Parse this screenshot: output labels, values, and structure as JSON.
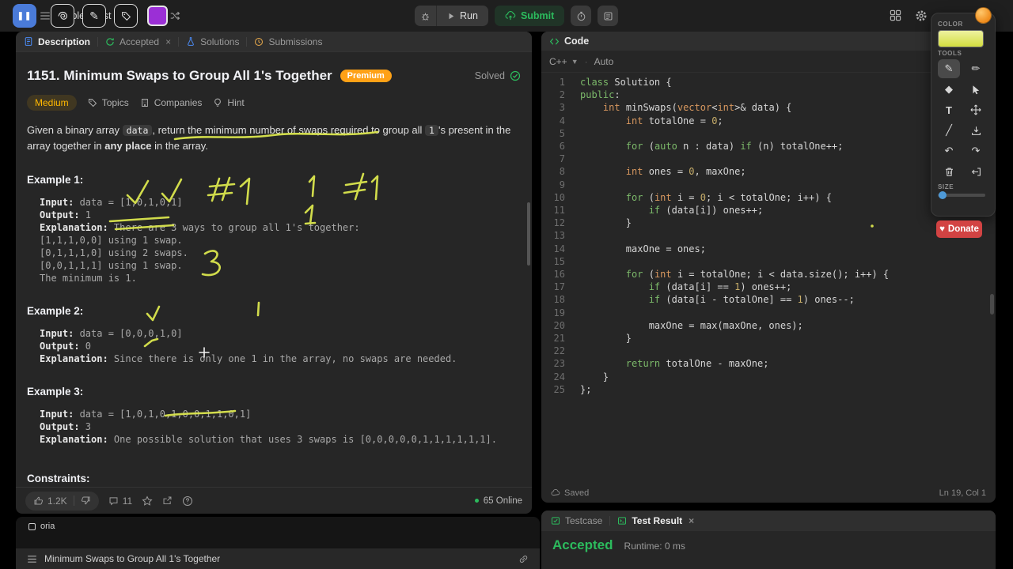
{
  "colors": {
    "accent_green": "#2cbb5d",
    "premium_orange": "#ffa116",
    "medium_yellow": "#ffb800",
    "annotation_yellow_green": "#dbe64e",
    "donate_red": "#d24343",
    "slider_blue": "#4e9ad8",
    "pause_blue": "#4a7bd9",
    "swatch_purple": "#9b2fd6"
  },
  "topbar": {
    "problem_list": "Problem List",
    "run": "Run",
    "submit": "Submit"
  },
  "left_panel": {
    "tabs": {
      "description": "Description",
      "accepted": "Accepted",
      "solutions": "Solutions",
      "submissions": "Submissions"
    },
    "header": {
      "title": "1151. Minimum Swaps to Group All 1's Together",
      "premium": "Premium",
      "solved": "Solved"
    },
    "meta": {
      "difficulty": "Medium",
      "topics": "Topics",
      "companies": "Companies",
      "hint": "Hint"
    },
    "description": {
      "p1": "Given a binary array ",
      "code1": "data",
      "p2": ", return the minimum number of swaps required to group all ",
      "code2": "1",
      "p3": "'s present in the array together in ",
      "bold": "any place",
      "p4": " in the array."
    },
    "example_labels": {
      "input": "Input:",
      "output": "Output:",
      "explanation": "Explanation:"
    },
    "examples": [
      {
        "label": "Example 1:",
        "input": "data = [1,0,1,0,1]",
        "output": "1",
        "explanation": [
          "There are 3 ways to group all 1's together:",
          "[1,1,1,0,0] using 1 swap.",
          "[0,1,1,1,0] using 2 swaps.",
          "[0,0,1,1,1] using 1 swap.",
          "The minimum is 1."
        ]
      },
      {
        "label": "Example 2:",
        "input": "data = [0,0,0,1,0]",
        "output": "0",
        "explanation": [
          "Since there is only one 1 in the array, no swaps are needed."
        ]
      },
      {
        "label": "Example 3:",
        "input": "data = [1,0,1,0,1,0,0,1,1,0,1]",
        "output": "3",
        "explanation": [
          "One possible solution that uses 3 swaps is [0,0,0,0,0,1,1,1,1,1,1]."
        ]
      }
    ],
    "constraints_label": "Constraints:",
    "footer": {
      "likes": "1.2K",
      "comments": "11",
      "online": "65 Online"
    }
  },
  "code_panel": {
    "tab": "Code",
    "language": "C++",
    "auto": "Auto",
    "lines": [
      "class Solution {",
      "public:",
      "    int minSwaps(vector<int>& data) {",
      "        int totalOne = 0;",
      "",
      "        for (auto n : data) if (n) totalOne++;",
      "",
      "        int ones = 0, maxOne;",
      "",
      "        for (int i = 0; i < totalOne; i++) {",
      "            if (data[i]) ones++;",
      "        }",
      "",
      "        maxOne = ones;",
      "",
      "        for (int i = totalOne; i < data.size(); i++) {",
      "            if (data[i] == 1) ones++;",
      "            if (data[i - totalOne] == 1) ones--;",
      "",
      "            maxOne = max(maxOne, ones);",
      "        }",
      "",
      "        return totalOne - maxOne;",
      "    }",
      "};"
    ],
    "saved": "Saved",
    "cursor": "Ln 19, Col 1"
  },
  "result_panel": {
    "testcase_tab": "Testcase",
    "result_tab": "Test Result",
    "status": "Accepted",
    "runtime": "Runtime: 0 ms"
  },
  "annotation_tool": {
    "color_label": "COLOR",
    "tools_label": "TOOLS",
    "size_label": "SIZE",
    "donate": "Donate",
    "current_color": "#dbe64e",
    "selected_tool": "pen",
    "tools": [
      "pen",
      "marker",
      "eraser",
      "cursor",
      "text",
      "move",
      "line",
      "save",
      "undo",
      "redo",
      "trash",
      "exit"
    ]
  },
  "bottom_bar": {
    "partial_text": "oria",
    "title": "Minimum Swaps to Group All 1's Together"
  }
}
